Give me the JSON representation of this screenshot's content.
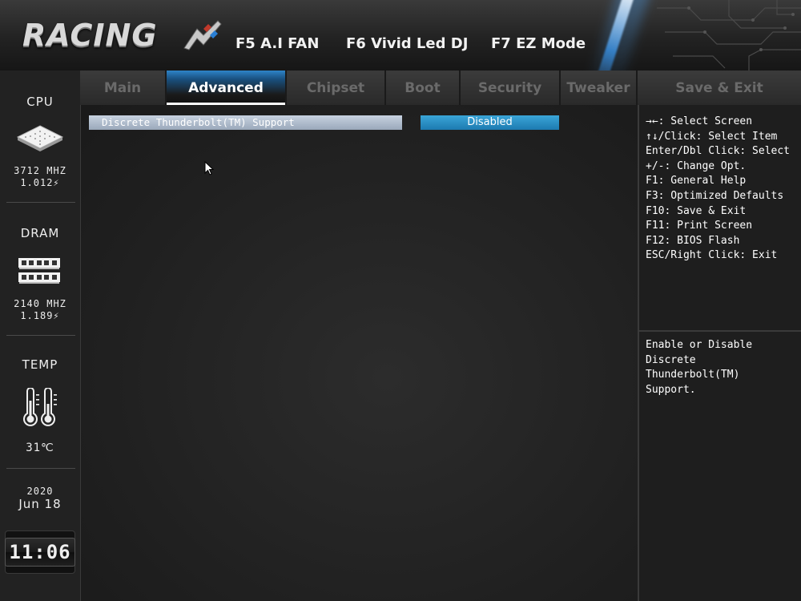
{
  "header": {
    "logo": "RACING",
    "hotkeys": {
      "fan": "F5 A.I FAN",
      "led": "F6 Vivid Led DJ",
      "ez": "F7 EZ Mode"
    }
  },
  "sidebar": {
    "cpu": {
      "label": "CPU",
      "freq": "3712 MHZ",
      "volt": "1.012⚡",
      "icon": "cpu-chip-icon"
    },
    "dram": {
      "label": "DRAM",
      "freq": "2140 MHZ",
      "volt": "1.189⚡",
      "icon": "memory-module-icon"
    },
    "temp": {
      "label": "TEMP",
      "value": "31℃",
      "icon": "thermometer-icon"
    },
    "date": {
      "year": "2020",
      "month_day": "Jun 18"
    },
    "time": "11:06"
  },
  "tabs": [
    {
      "label": "Main",
      "active": false
    },
    {
      "label": "Advanced",
      "active": true
    },
    {
      "label": "Chipset",
      "active": false
    },
    {
      "label": "Boot",
      "active": false
    },
    {
      "label": "Security",
      "active": false
    },
    {
      "label": "Tweaker",
      "active": false
    },
    {
      "label": "Save & Exit",
      "active": false
    }
  ],
  "main": {
    "setting": {
      "label": "Discrete Thunderbolt(TM) Support",
      "value": "Disabled"
    }
  },
  "help": {
    "keys": [
      "→←: Select Screen",
      "↑↓/Click: Select Item",
      "Enter/Dbl Click: Select",
      "+/-: Change Opt.",
      "F1: General Help",
      "F3: Optimized Defaults",
      "F10: Save & Exit",
      "F11: Print Screen",
      "F12: BIOS Flash",
      "ESC/Right Click: Exit"
    ],
    "description": "Enable or Disable\nDiscrete\nThunderbolt(TM)\nSupport."
  },
  "colors": {
    "accent": "#1d7ab0",
    "active_tab": "#2e84c8",
    "background": "#1b1b1b"
  }
}
